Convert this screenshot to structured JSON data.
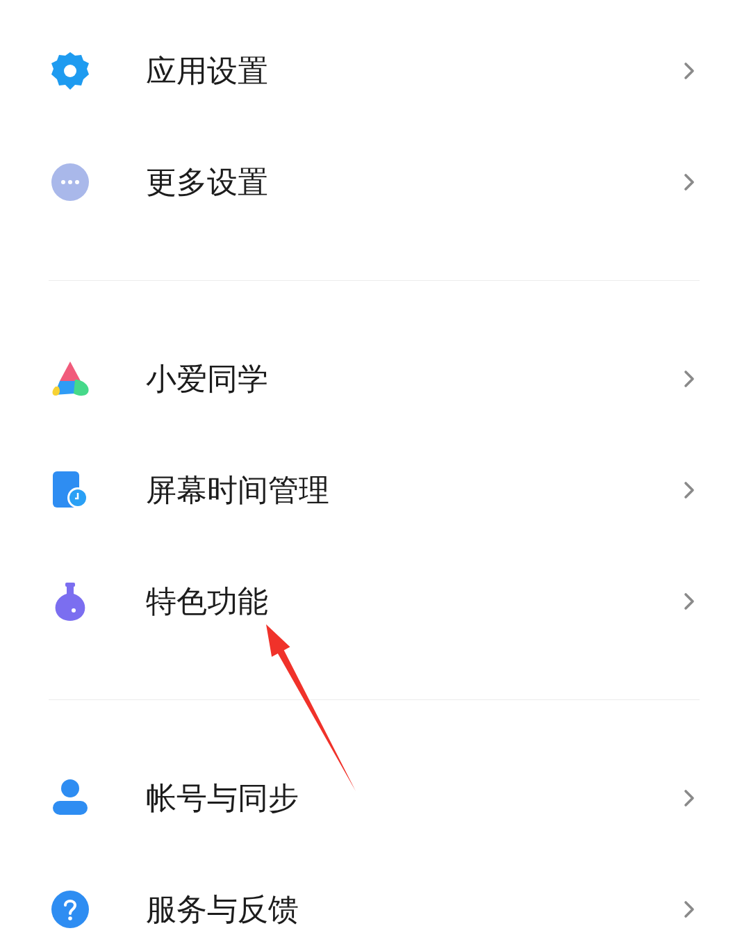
{
  "groups": [
    {
      "items": [
        {
          "kind": "gear",
          "label": "应用设置"
        },
        {
          "kind": "more",
          "label": "更多设置"
        }
      ]
    },
    {
      "items": [
        {
          "kind": "assistant",
          "label": "小爱同学"
        },
        {
          "kind": "screen-time",
          "label": "屏幕时间管理"
        },
        {
          "kind": "flask",
          "label": "特色功能"
        }
      ]
    },
    {
      "items": [
        {
          "kind": "account",
          "label": "帐号与同步"
        },
        {
          "kind": "help",
          "label": "服务与反馈"
        }
      ]
    }
  ]
}
